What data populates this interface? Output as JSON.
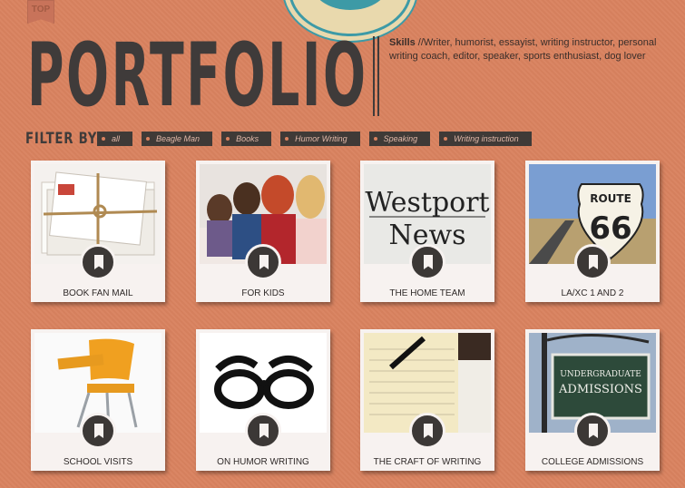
{
  "nav": {
    "top_label": "TOP"
  },
  "header": {
    "title": "PORTFOLIO",
    "skills_label": "Skills",
    "skills_text": " //Writer, humorist, essayist, writing instructor, personal writing coach, editor, speaker, sports enthusiast, dog lover"
  },
  "filters": {
    "label": "FILTER BY:",
    "items": [
      "all",
      "Beagle Man",
      "Books",
      "Humor Writing",
      "Speaking",
      "Writing instruction"
    ]
  },
  "portfolio": {
    "items": [
      {
        "label": "BOOK FAN MAIL",
        "icon": "bookmark-icon"
      },
      {
        "label": "FOR KIDS",
        "icon": "bookmark-icon"
      },
      {
        "label": "THE HOME TEAM",
        "icon": "bookmark-icon",
        "image_text": [
          "Westport",
          "News"
        ]
      },
      {
        "label": "LA/XC 1 AND 2",
        "icon": "bookmark-icon",
        "image_text": [
          "ROUTE",
          "66"
        ]
      },
      {
        "label": "SCHOOL VISITS",
        "icon": "bookmark-icon"
      },
      {
        "label": "ON HUMOR WRITING",
        "icon": "bookmark-icon"
      },
      {
        "label": "THE CRAFT OF WRITING",
        "icon": "bookmark-icon"
      },
      {
        "label": "COLLEGE ADMISSIONS",
        "icon": "bookmark-icon",
        "image_text": [
          "UNDERGRADUATE",
          "ADMISSIONS"
        ]
      }
    ]
  },
  "colors": {
    "background": "#d9825f",
    "dark": "#3f3b3a",
    "card": "#f7f2f0",
    "accent": "#3d9aa6"
  }
}
